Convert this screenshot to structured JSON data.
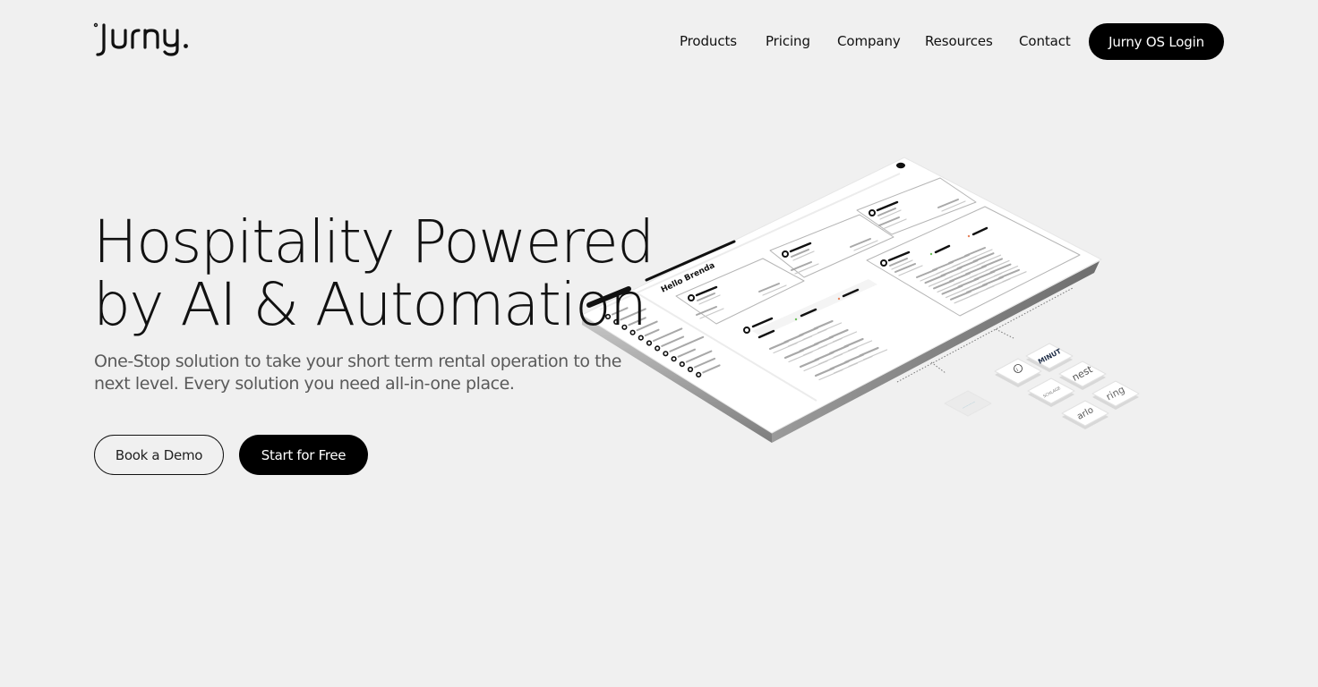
{
  "brand": {
    "logo_text": "jurny."
  },
  "nav": {
    "links": [
      {
        "label": "Products"
      },
      {
        "label": "Pricing"
      },
      {
        "label": "Company"
      },
      {
        "label": "Resources"
      },
      {
        "label": "Contact"
      }
    ],
    "login_label": "Jurny OS Login"
  },
  "hero": {
    "title_line1": "Hospitality Powered",
    "title_line2": "by AI & Automation",
    "subtitle": "One-Stop solution to take your short term rental operation to the next level. Every solution you need all-in-one place.",
    "primary_cta": "Start for Free",
    "secondary_cta": "Book a Demo"
  },
  "illustration": {
    "dashboard_greeting": "Hello Brenda",
    "integration_tiles": [
      {
        "name": "minut",
        "label": "MINUT"
      },
      {
        "name": "nest",
        "label": "nest"
      },
      {
        "name": "ring",
        "label": "ring"
      },
      {
        "name": "arlo",
        "label": "arlo"
      },
      {
        "name": "info",
        "label": "i"
      },
      {
        "name": "schlage",
        "label": "SCHLAGE"
      },
      {
        "name": "faded",
        "label": "————"
      }
    ]
  },
  "colors": {
    "background": "#f0f0f0",
    "primary": "#000000",
    "text_muted": "#5a5a5a",
    "panel": "#ffffff",
    "panel_edge": "#8a8a8a"
  }
}
